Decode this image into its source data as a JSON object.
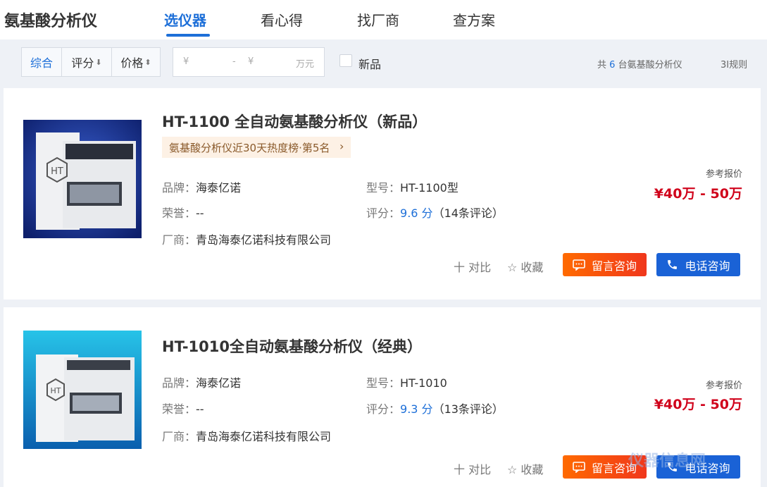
{
  "header": {
    "brand": "氨基酸分析仪",
    "tabs": [
      {
        "label": "选仪器",
        "active": true
      },
      {
        "label": "看心得",
        "active": false
      },
      {
        "label": "找厂商",
        "active": false
      },
      {
        "label": "查方案",
        "active": false
      }
    ]
  },
  "filter": {
    "sort": [
      "综合",
      "评分",
      "价格"
    ],
    "sort_arrows": {
      "score": "⬇",
      "price": "⬍"
    },
    "price_currency": "¥",
    "price_dash": "-",
    "price_unit": "万元",
    "new_label": "新品",
    "total_prefix": "共",
    "total_count": "6",
    "total_suffix": "台氨基酸分析仪",
    "rule_link": "3I规则"
  },
  "labels": {
    "brand": "品牌：",
    "model": "型号：",
    "honor": "荣誉：",
    "score": "评分：",
    "maker": "厂商：",
    "ref_price": "参考报价",
    "compare": "十 对比",
    "favorite": "☆ 收藏",
    "msg_btn": "留言咨询",
    "phone_btn": "电话咨询"
  },
  "products": [
    {
      "title": "HT-1100 全自动氨基酸分析仪（新品）",
      "rank": "氨基酸分析仪近30天热度榜·第5名",
      "brand": "海泰亿诺",
      "model": "HT-1100型",
      "honor": "--",
      "score": "9.6 分",
      "reviews": "（14条评论）",
      "maker": "青岛海泰亿诺科技有限公司",
      "price": "¥40万 - 50万"
    },
    {
      "title": "HT-1010全自动氨基酸分析仪（经典）",
      "brand": "海泰亿诺",
      "model": "HT-1010",
      "honor": "--",
      "score": "9.3 分",
      "reviews": "（13条评论）",
      "maker": "青岛海泰亿诺科技有限公司",
      "price": "¥40万 - 50万"
    }
  ],
  "watermark": "仪器信息网",
  "colors": {
    "accent": "#1d6fd8",
    "price": "#d0021b",
    "msg_button": "#f0371c",
    "phone_button": "#1a62d6"
  }
}
